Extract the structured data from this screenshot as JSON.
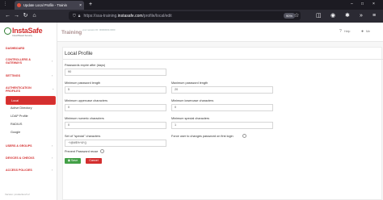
{
  "browser": {
    "tab_title": "Update Local Profile - Trainin",
    "tab_close": "×",
    "new_tab": "+",
    "url_prefix": "https://ssa-training.",
    "url_host": "instasafe.com",
    "url_path": "/profile/local/edit",
    "zoom": "90%",
    "back": "←",
    "forward": "→",
    "reload": "↻",
    "home": "⌂",
    "bookmark_star": "☆",
    "shield": "⛉",
    "lock": "🔒"
  },
  "sidebar": {
    "logo_text": "InstaSafe",
    "logo_subtext": "Cloud Based Security",
    "sections": [
      {
        "label": "DASHBOARD",
        "chevron": ""
      },
      {
        "label": "CONTROLLERS &",
        "label2": "GATEWAYS",
        "chevron": "›"
      },
      {
        "label": "SETTINGS",
        "chevron": "›"
      },
      {
        "label": "AUTHENTICATION",
        "label2": "PROFILES",
        "chevron": "⌄"
      },
      {
        "label": "USERS & GROUPS",
        "chevron": "›"
      },
      {
        "label": "DEVICES & CHECKS",
        "chevron": "›"
      },
      {
        "label": "ACCESS POLICIES",
        "chevron": "›"
      }
    ],
    "active_item": "Local",
    "sub_items": [
      "Active Directory",
      "LDAP Profile",
      "RADIUS",
      "Google"
    ],
    "footer": "Version: production/1.2"
  },
  "header": {
    "title": "Training",
    "crumb": "your session ID: 00000000-0000",
    "help_label": "Help",
    "user_label": "Me"
  },
  "form": {
    "title": "Local Profile",
    "fields": [
      {
        "label": "Passwords expire after (days)",
        "value": "90"
      },
      {
        "label": "Minimum password length",
        "value": "5"
      },
      {
        "label": "Maximum password length",
        "value": "20"
      },
      {
        "label": "Minimum uppercase characters",
        "value": "0"
      },
      {
        "label": "Minimum lowercase characters",
        "value": "0"
      },
      {
        "label": "Minimum numeric characters",
        "value": "0"
      },
      {
        "label": "Minimum special characters",
        "value": "1"
      },
      {
        "label": "Set of \"special\" characters",
        "value": "~!@#$%^&*()"
      }
    ],
    "force_change_label": "Force user to changes password on first login",
    "prevent_reuse_label": "Prevent Password reuse",
    "save_label": "Save",
    "cancel_label": "Cancel"
  }
}
